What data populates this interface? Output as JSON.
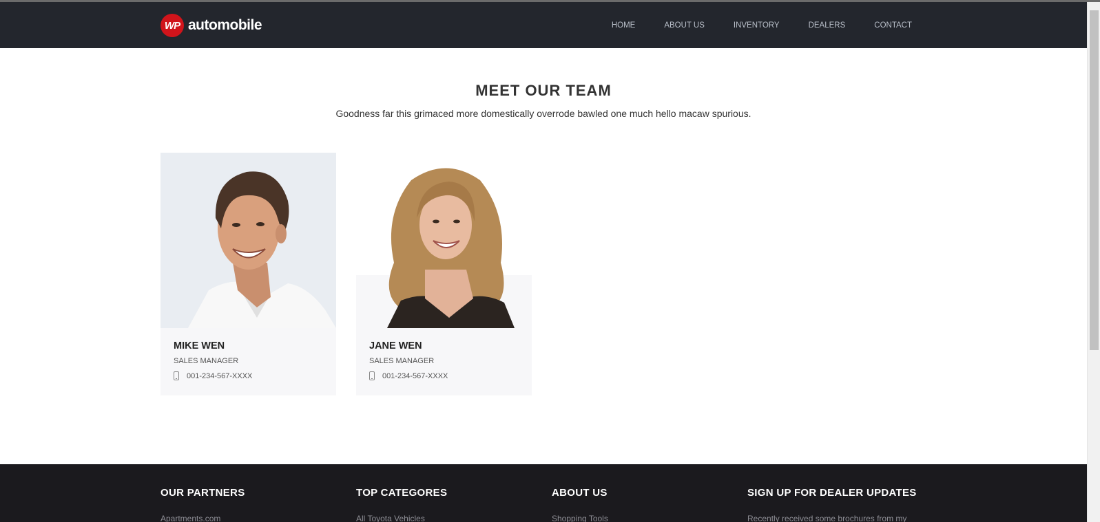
{
  "header": {
    "logo_badge": "WP",
    "logo_text": "automobile",
    "nav": [
      "HOME",
      "ABOUT US",
      "INVENTORY",
      "DEALERS",
      "CONTACT"
    ]
  },
  "section": {
    "title": "MEET OUR TEAM",
    "subtitle": "Goodness far this grimaced more domestically overrode bawled one much hello macaw spurious."
  },
  "team": [
    {
      "name": "MIKE WEN",
      "role": "SALES MANAGER",
      "phone": "001-234-567-XXXX"
    },
    {
      "name": "JANE WEN",
      "role": "SALES MANAGER",
      "phone": "001-234-567-XXXX"
    }
  ],
  "footer": {
    "columns": [
      {
        "title": "OUR PARTNERS",
        "link": "Apartments.com"
      },
      {
        "title": "TOP CATEGORES",
        "link": "All Toyota Vehicles"
      },
      {
        "title": "ABOUT US",
        "link": "Shopping Tools"
      },
      {
        "title": "SIGN UP FOR DEALER UPDATES",
        "link": "Recently received some brochures from my"
      }
    ]
  },
  "colors": {
    "header_bg": "#23262d",
    "brand_red": "#d0141b",
    "footer_bg": "#1b1a1e",
    "card_info_bg": "#f7f7f9"
  }
}
